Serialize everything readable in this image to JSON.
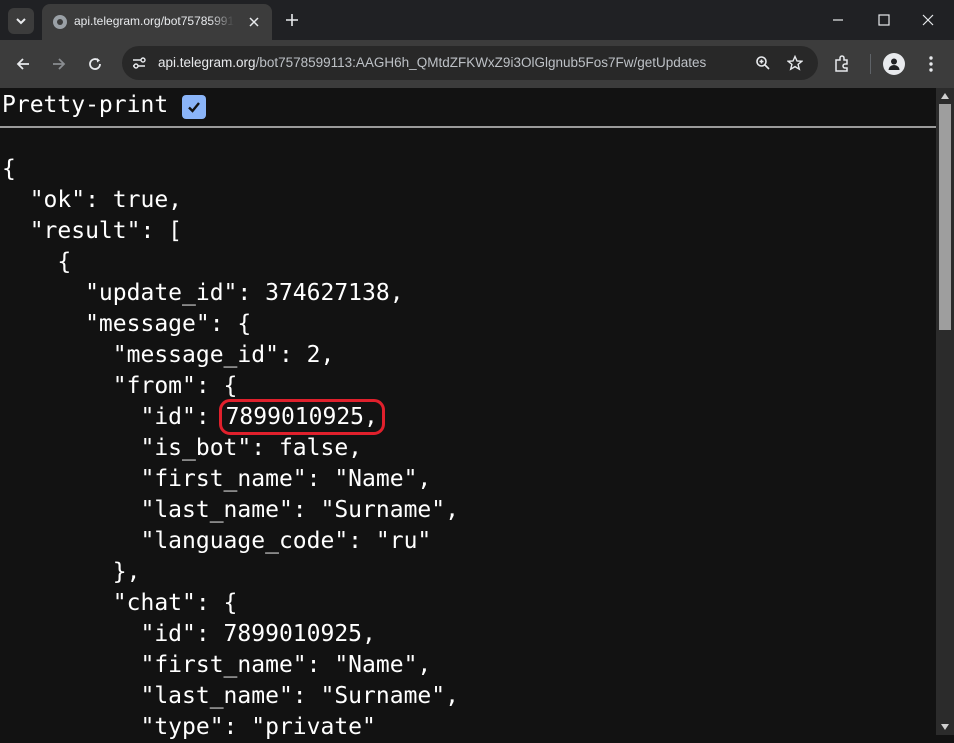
{
  "browser": {
    "tab_title": "api.telegram.org/bot7578599113",
    "url_host": "api.telegram.org",
    "url_path": "/bot7578599113:AAGH6h_QMtdZFKWxZ9i3OlGlgnub5Fos7Fw/getUpdates",
    "icons": [
      "tab-search-icon",
      "globe-icon",
      "close-icon",
      "plus-icon",
      "minimize-icon",
      "maximize-icon",
      "close-window-icon",
      "back-icon",
      "forward-icon",
      "reload-icon",
      "site-info-icon",
      "zoom-icon",
      "star-icon",
      "extensions-icon",
      "profile-icon",
      "more-icon"
    ]
  },
  "page": {
    "pretty_print_label": "Pretty-print",
    "pretty_print_checked": true,
    "json_lines": {
      "l1": "{",
      "l2": "  \"ok\": true,",
      "l3": "  \"result\": [",
      "l4": "    {",
      "l5": "      \"update_id\": 374627138,",
      "l6": "      \"message\": {",
      "l7": "        \"message_id\": 2,",
      "l8": "        \"from\": {",
      "l9_prefix": "          \"id\": ",
      "l9_value": "7899010925,",
      "l10": "          \"is_bot\": false,",
      "l11": "          \"first_name\": \"Name\",",
      "l12": "          \"last_name\": \"Surname\",",
      "l13": "          \"language_code\": \"ru\"",
      "l14": "        },",
      "l15": "        \"chat\": {",
      "l16": "          \"id\": 7899010925,",
      "l17": "          \"first_name\": \"Name\",",
      "l18": "          \"last_name\": \"Surname\",",
      "l19": "          \"type\": \"private\""
    },
    "highlight_color": "#e0202c"
  }
}
